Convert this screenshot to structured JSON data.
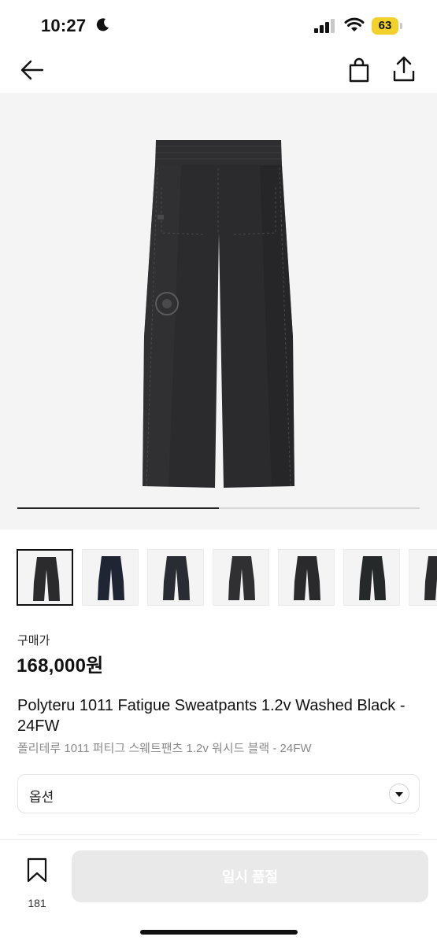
{
  "status_bar": {
    "time": "10:27",
    "battery": "63",
    "icons": [
      "moon-icon",
      "signal-icon",
      "wifi-icon",
      "battery-icon"
    ],
    "battery_color": "#f1d12a"
  },
  "nav": {
    "icons": [
      "back-arrow-icon",
      "shopping-bag-icon",
      "share-icon"
    ]
  },
  "gallery": {
    "image_progress": 0.5,
    "thumbnail_count": 7,
    "active_thumbnail": 0
  },
  "product": {
    "price_label": "구매가",
    "price": "168,000원",
    "name_en": "Polyteru 1011 Fatigue Sweatpants 1.2v Washed Black - 24FW",
    "name_ko": "폴리테루 1011 퍼티그 스웨트팬츠 1.2v 워시드 블랙 - 24FW"
  },
  "option": {
    "label": "옵션",
    "icon": "chevron-down-icon"
  },
  "bottom_bar": {
    "wish_count": "181",
    "wish_icon": "bookmark-icon",
    "cta_label": "일시 품절",
    "cta_color": "#e9e9e9"
  }
}
